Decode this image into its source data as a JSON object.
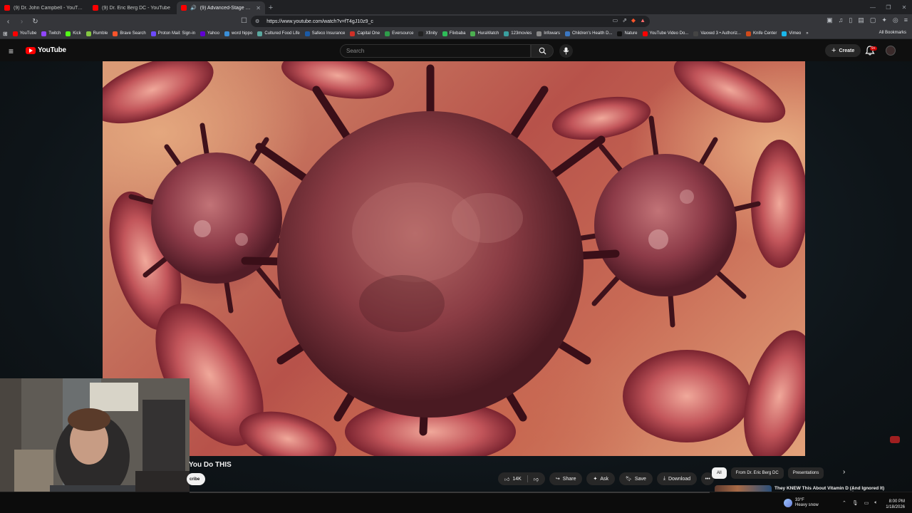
{
  "browser": {
    "tabs": [
      {
        "title": "(9) Dr. John Campbell - YouTube",
        "active": false
      },
      {
        "title": "(9) Dr. Eric Berg DC - YouTube",
        "active": false
      },
      {
        "title": "(9) Advanced-Stage Colon Ca",
        "active": true
      }
    ],
    "url": "https://www.youtube.com/watch?v=fT4gJ10z9_c",
    "bookmarks": [
      {
        "label": "YouTube",
        "color": "#ff0000"
      },
      {
        "label": "Twitch",
        "color": "#9146ff"
      },
      {
        "label": "Kick",
        "color": "#53fc18"
      },
      {
        "label": "Rumble",
        "color": "#85c742"
      },
      {
        "label": "Brave Search",
        "color": "#fb542b"
      },
      {
        "label": "Proton Mail: Sign-in",
        "color": "#6d4aff"
      },
      {
        "label": "Yahoo",
        "color": "#6001d2"
      },
      {
        "label": "word hippo",
        "color": "#3a8fd8"
      },
      {
        "label": "Cultured Food Life",
        "color": "#5aa9a0"
      },
      {
        "label": "Safeco Insurance",
        "color": "#1a5aa6"
      },
      {
        "label": "Capital One",
        "color": "#d03027"
      },
      {
        "label": "Eversource",
        "color": "#2e9c4a"
      },
      {
        "label": "Xfinity",
        "color": "#222222"
      },
      {
        "label": "Flixbaba",
        "color": "#2ebd59"
      },
      {
        "label": "HuraWatch",
        "color": "#4caf50"
      },
      {
        "label": "123movies",
        "color": "#3aa0a0"
      },
      {
        "label": "Infowars",
        "color": "#888888"
      },
      {
        "label": "Children's Health D...",
        "color": "#3b77c2"
      },
      {
        "label": "Nature",
        "color": "#111111"
      },
      {
        "label": "YouTube Video Do...",
        "color": "#ff0000"
      },
      {
        "label": "Vaxxed 3 • Authoriz...",
        "color": "#444444"
      },
      {
        "label": "Knife Center",
        "color": "#d04a1a"
      },
      {
        "label": "Vimeo",
        "color": "#1ab7ea"
      }
    ],
    "all_bookmarks": "All Bookmarks"
  },
  "youtube": {
    "logo_text": "YouTube",
    "search_placeholder": "Search",
    "create_label": "Create",
    "notifications_badge": "9+",
    "video_title_partial": "You Do THIS",
    "subscribe_partial": "cribe",
    "like_count": "14K",
    "share_label": "Share",
    "ask_label": "Ask",
    "save_label": "Save",
    "download_label": "Download",
    "chips": [
      "All",
      "From Dr. Eric Berg DC",
      "Presentations"
    ],
    "recommended": [
      {
        "title": "They KNEW This About Vitamin D (And Ignored It)"
      }
    ]
  },
  "taskbar": {
    "weather_temp": "33°F",
    "weather_desc": "Heavy snow",
    "time": "8:00 PM",
    "date": "1/18/2026"
  }
}
